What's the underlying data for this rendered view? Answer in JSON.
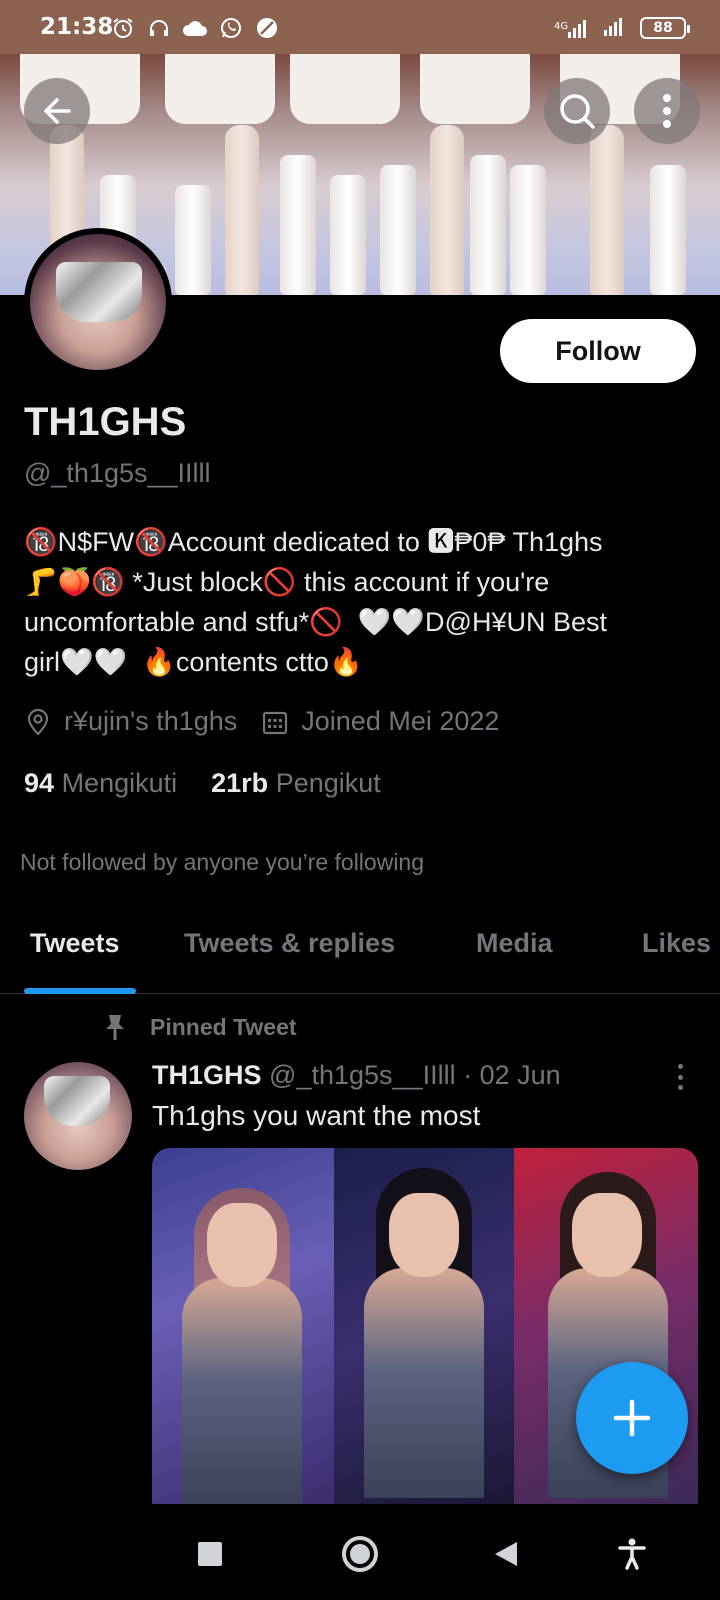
{
  "status_bar": {
    "time": "21:38",
    "network_label": "4G",
    "battery": "88",
    "icons": [
      "alarm-icon",
      "headphones-icon",
      "cloud-icon",
      "whatsapp-icon",
      "no-disturb-icon",
      "signal-icon",
      "signal-icon",
      "battery-icon"
    ]
  },
  "header_buttons": {
    "back": "back-arrow-icon",
    "search": "search-icon",
    "more": "more-vertical-icon"
  },
  "profile": {
    "follow_label": "Follow",
    "display_name": "TH1GHS",
    "handle": "@_th1g5s__IIlll",
    "bio": "🔞N$FW🔞Account dedicated to 🅺₱0₱ Th1ghs\n🦵🍑🔞 *Just block🚫 this account if you're\nuncomfortable and stfu*🚫  🤍🤍D@H¥UN Best\ngirl🤍🤍  🔥contents ctto🔥",
    "location": "r¥ujin's th1ghs",
    "joined": "Joined Mei 2022",
    "following_count": "94",
    "following_label": "Mengikuti",
    "followers_count": "21rb",
    "followers_label": "Pengikut",
    "not_followed": "Not followed by anyone you’re following"
  },
  "tabs": [
    {
      "label": "Tweets",
      "active": true
    },
    {
      "label": "Tweets & replies",
      "active": false
    },
    {
      "label": "Media",
      "active": false
    },
    {
      "label": "Likes",
      "active": false
    }
  ],
  "pinned_tweet": {
    "pinned_label": "Pinned Tweet",
    "author_name": "TH1GHS",
    "author_handle": "@_th1g5s__IIlll",
    "separator": "·",
    "date": "02 Jun",
    "text": "Th1ghs you want the most"
  },
  "colors": {
    "accent": "#1d9bf0",
    "status_bar_bg": "#8b6350",
    "background": "#000000",
    "secondary_text": "#71767b"
  },
  "nav_bar": {
    "icons": [
      "recents-square-icon",
      "home-circle-icon",
      "back-triangle-icon",
      "accessibility-icon"
    ]
  }
}
